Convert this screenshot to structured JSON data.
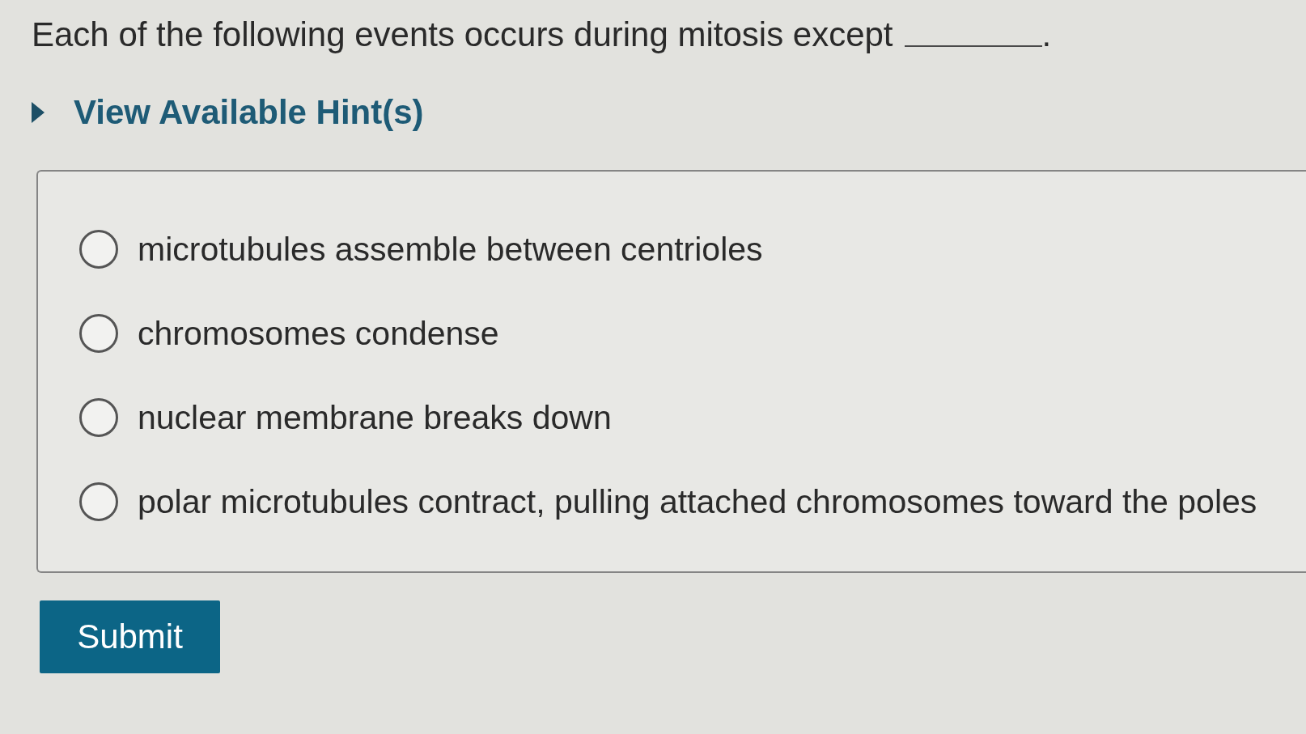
{
  "question": {
    "text": "Each of the following events occurs during mitosis except",
    "end": "."
  },
  "hints": {
    "label": "View Available Hint(s)",
    "expanded": false
  },
  "options": [
    {
      "label": "microtubules assemble between centrioles",
      "selected": false
    },
    {
      "label": "chromosomes condense",
      "selected": false
    },
    {
      "label": "nuclear membrane breaks down",
      "selected": false
    },
    {
      "label": "polar microtubules contract, pulling attached chromosomes toward the poles",
      "selected": false
    }
  ],
  "submit": {
    "label": "Submit"
  }
}
